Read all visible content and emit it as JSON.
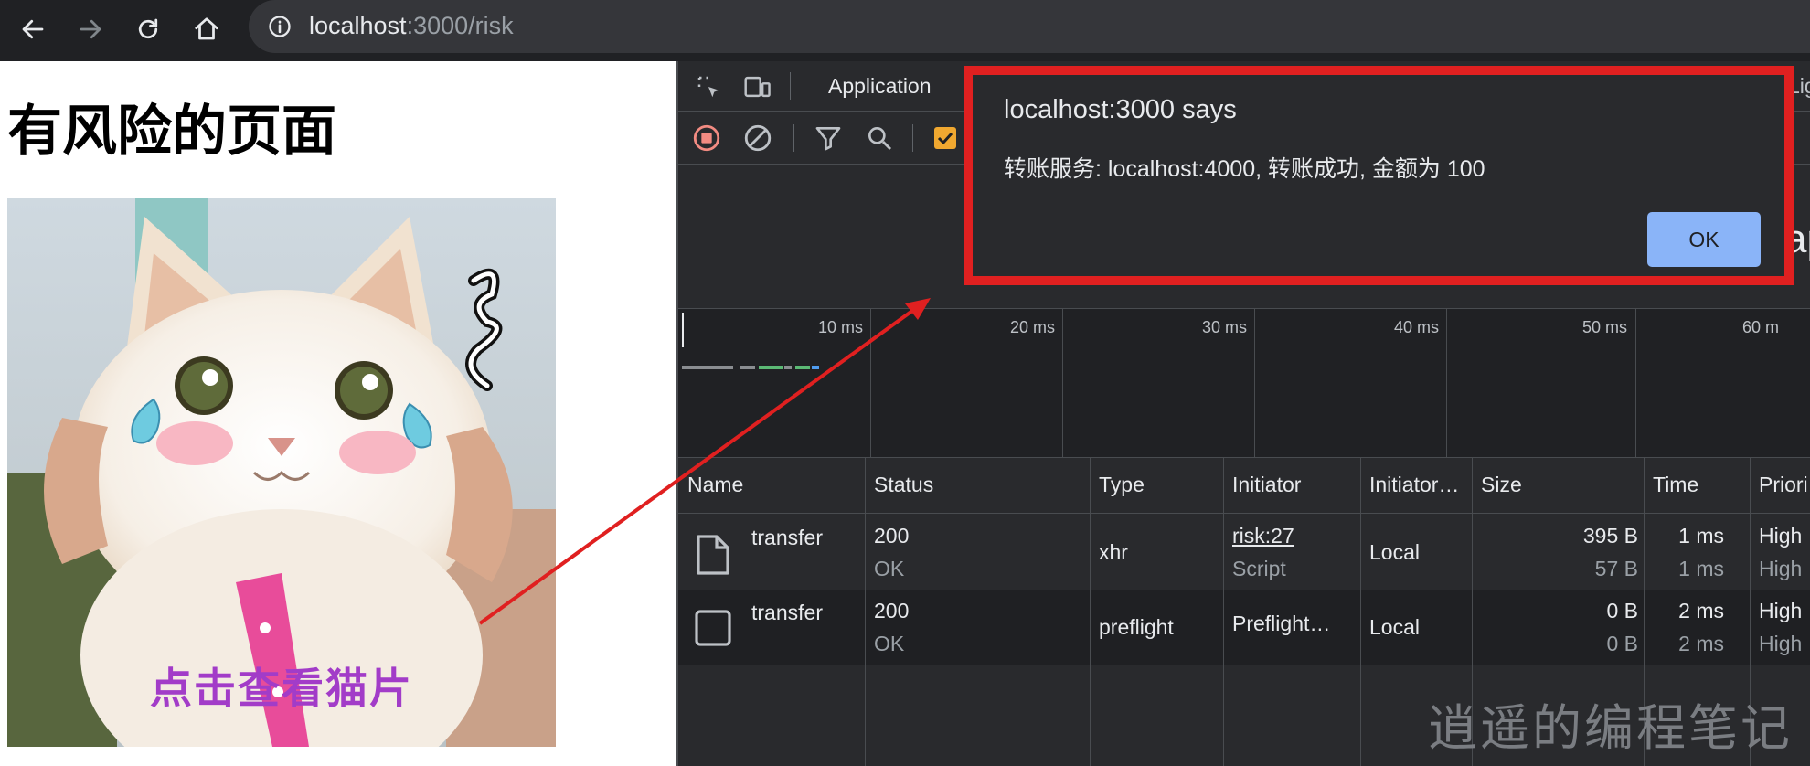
{
  "browser": {
    "url_host": "localhost",
    "url_path": ":3000/risk"
  },
  "page": {
    "title": "有风险的页面",
    "caption": "点击查看猫片"
  },
  "devtools": {
    "tab_application": "Application",
    "tab_partial": "Lig",
    "partial_text": "ap",
    "timeline_labels": [
      "10 ms",
      "20 ms",
      "30 ms",
      "40 ms",
      "50 ms",
      "60 m"
    ],
    "columns": [
      "Name",
      "Status",
      "Type",
      "Initiator",
      "Initiator…",
      "Size",
      "Time",
      "Priori"
    ],
    "rows": [
      {
        "name": "transfer",
        "status": "200",
        "status_text": "OK",
        "type": "xhr",
        "initiator": "risk:27",
        "initiator_sub": "Script",
        "initiator_address": "Local",
        "size": "395 B",
        "size_sub": "57 B",
        "time": "1 ms",
        "time_sub": "1 ms",
        "priority": "High",
        "priority_sub": "High"
      },
      {
        "name": "transfer",
        "status": "200",
        "status_text": "OK",
        "type": "preflight",
        "initiator": "Preflight…",
        "initiator_sub": "",
        "initiator_address": "Local",
        "size": "0 B",
        "size_sub": "0 B",
        "time": "2 ms",
        "time_sub": "2 ms",
        "priority": "High",
        "priority_sub": "High"
      }
    ]
  },
  "dialog": {
    "title": "localhost:3000 says",
    "message": "转账服务: localhost:4000, 转账成功, 金额为 100",
    "ok_label": "OK"
  },
  "watermark": "逍遥的编程笔记",
  "colors": {
    "highlight_border": "#e02020",
    "caption": "#a23cc8",
    "ok_button": "#8ab4f8"
  }
}
